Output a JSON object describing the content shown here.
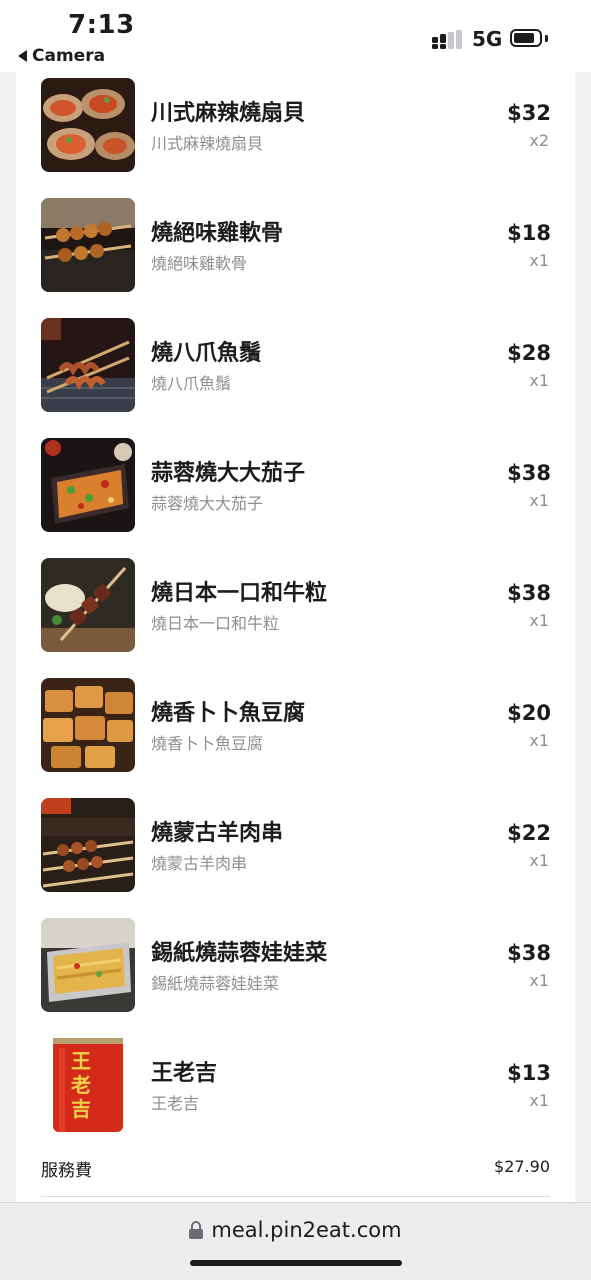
{
  "status_bar": {
    "time": "7:13",
    "back_label": "Camera",
    "network": "5G",
    "battery_level": 0.85
  },
  "order": {
    "items": [
      {
        "name": "川式麻辣燒扇貝",
        "subtitle": "川式麻辣燒扇貝",
        "price": "$32",
        "qty": "x2",
        "image_icon": "scallop-food-icon"
      },
      {
        "name": "燒絕味雞軟骨",
        "subtitle": "燒絕味雞軟骨",
        "price": "$18",
        "qty": "x1",
        "image_icon": "skewer-food-icon"
      },
      {
        "name": "燒八爪魚鬚",
        "subtitle": "燒八爪魚鬚",
        "price": "$28",
        "qty": "x1",
        "image_icon": "octopus-skewer-icon"
      },
      {
        "name": "蒜蓉燒大大茄子",
        "subtitle": "蒜蓉燒大大茄子",
        "price": "$38",
        "qty": "x1",
        "image_icon": "eggplant-dish-icon"
      },
      {
        "name": "燒日本一口和牛粒",
        "subtitle": "燒日本一口和牛粒",
        "price": "$38",
        "qty": "x1",
        "image_icon": "beef-skewer-icon"
      },
      {
        "name": "燒香卜卜魚豆腐",
        "subtitle": "燒香卜卜魚豆腐",
        "price": "$20",
        "qty": "x1",
        "image_icon": "fish-tofu-icon"
      },
      {
        "name": "燒蒙古羊肉串",
        "subtitle": "燒蒙古羊肉串",
        "price": "$22",
        "qty": "x1",
        "image_icon": "lamb-skewer-icon"
      },
      {
        "name": "錫紙燒蒜蓉娃娃菜",
        "subtitle": "錫紙燒蒜蓉娃娃菜",
        "price": "$38",
        "qty": "x1",
        "image_icon": "foil-tray-icon"
      },
      {
        "name": "王老吉",
        "subtitle": "王老吉",
        "price": "$13",
        "qty": "x1",
        "image_icon": "drink-can-icon"
      }
    ],
    "service_fee_label": "服務費",
    "service_fee_value": "$27.90",
    "can_brand_text": "王老吉"
  },
  "browser": {
    "url": "meal.pin2eat.com"
  }
}
